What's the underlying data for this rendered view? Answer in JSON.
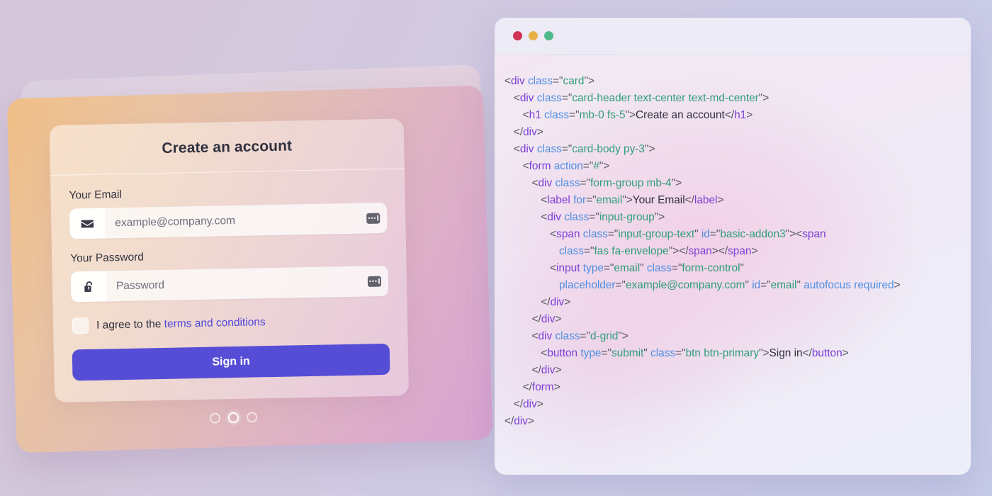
{
  "background": {
    "gradient_from": "#d5c6da",
    "gradient_to": "#c6cbe9"
  },
  "auth_card": {
    "title": "Create an account",
    "email": {
      "label": "Your Email",
      "placeholder": "example@company.com",
      "value": "",
      "addon_icon": "envelope-icon",
      "trailing_icon": "autofill-icon"
    },
    "password": {
      "label": "Your Password",
      "placeholder": "Password",
      "value": "",
      "addon_icon": "unlock-icon",
      "trailing_icon": "autofill-icon"
    },
    "agreement": {
      "checked": false,
      "text": "I agree to the ",
      "link_text": "terms and conditions",
      "link_color": "#4f47d8"
    },
    "submit": {
      "label": "Sign in",
      "color": "#564dd6"
    },
    "carousel": {
      "count": 3,
      "active_index": 1
    },
    "panel_gradient_from": "#f0bf87",
    "panel_gradient_to": "#d8a4d2"
  },
  "code_window": {
    "traffic_lights": [
      {
        "name": "close",
        "color": "#cf3253"
      },
      {
        "name": "minimize",
        "color": "#e9b148"
      },
      {
        "name": "maximize",
        "color": "#4fb98a"
      }
    ],
    "language": "html",
    "syntax_colors": {
      "tag": "#7b3fd4",
      "attribute": "#4f8fe0",
      "string": "#2f9e79",
      "text": "#2f2f3c",
      "punctuation": "#55555f"
    },
    "lines": [
      [
        {
          "t": "pun",
          "v": "<"
        },
        {
          "t": "tag",
          "v": "div"
        },
        {
          "t": "pun",
          "v": " "
        },
        {
          "t": "attr",
          "v": "class"
        },
        {
          "t": "pun",
          "v": "=\""
        },
        {
          "t": "str",
          "v": "card"
        },
        {
          "t": "pun",
          "v": "\">"
        }
      ],
      [
        {
          "t": "pun",
          "v": "   <"
        },
        {
          "t": "tag",
          "v": "div"
        },
        {
          "t": "pun",
          "v": " "
        },
        {
          "t": "attr",
          "v": "class"
        },
        {
          "t": "pun",
          "v": "=\""
        },
        {
          "t": "str",
          "v": "card-header text-center text-md-center"
        },
        {
          "t": "pun",
          "v": "\">"
        }
      ],
      [
        {
          "t": "pun",
          "v": "      <"
        },
        {
          "t": "tag",
          "v": "h1"
        },
        {
          "t": "pun",
          "v": " "
        },
        {
          "t": "attr",
          "v": "class"
        },
        {
          "t": "pun",
          "v": "=\""
        },
        {
          "t": "str",
          "v": "mb-0 fs-5"
        },
        {
          "t": "pun",
          "v": "\">"
        },
        {
          "t": "txt",
          "v": "Create an account"
        },
        {
          "t": "pun",
          "v": "</"
        },
        {
          "t": "tag",
          "v": "h1"
        },
        {
          "t": "pun",
          "v": ">"
        }
      ],
      [
        {
          "t": "pun",
          "v": "   </"
        },
        {
          "t": "tag",
          "v": "div"
        },
        {
          "t": "pun",
          "v": ">"
        }
      ],
      [
        {
          "t": "pun",
          "v": "   <"
        },
        {
          "t": "tag",
          "v": "div"
        },
        {
          "t": "pun",
          "v": " "
        },
        {
          "t": "attr",
          "v": "class"
        },
        {
          "t": "pun",
          "v": "=\""
        },
        {
          "t": "str",
          "v": "card-body py-3"
        },
        {
          "t": "pun",
          "v": "\">"
        }
      ],
      [
        {
          "t": "pun",
          "v": "      <"
        },
        {
          "t": "tag",
          "v": "form"
        },
        {
          "t": "pun",
          "v": " "
        },
        {
          "t": "attr",
          "v": "action"
        },
        {
          "t": "pun",
          "v": "=\""
        },
        {
          "t": "str",
          "v": "#"
        },
        {
          "t": "pun",
          "v": "\">"
        }
      ],
      [
        {
          "t": "pun",
          "v": "         <"
        },
        {
          "t": "tag",
          "v": "div"
        },
        {
          "t": "pun",
          "v": " "
        },
        {
          "t": "attr",
          "v": "class"
        },
        {
          "t": "pun",
          "v": "=\""
        },
        {
          "t": "str",
          "v": "form-group mb-4"
        },
        {
          "t": "pun",
          "v": "\">"
        }
      ],
      [
        {
          "t": "pun",
          "v": "            <"
        },
        {
          "t": "tag",
          "v": "label"
        },
        {
          "t": "pun",
          "v": " "
        },
        {
          "t": "attr",
          "v": "for"
        },
        {
          "t": "pun",
          "v": "=\""
        },
        {
          "t": "str",
          "v": "email"
        },
        {
          "t": "pun",
          "v": "\">"
        },
        {
          "t": "txt",
          "v": "Your Email"
        },
        {
          "t": "pun",
          "v": "</"
        },
        {
          "t": "tag",
          "v": "label"
        },
        {
          "t": "pun",
          "v": ">"
        }
      ],
      [
        {
          "t": "pun",
          "v": "            <"
        },
        {
          "t": "tag",
          "v": "div"
        },
        {
          "t": "pun",
          "v": " "
        },
        {
          "t": "attr",
          "v": "class"
        },
        {
          "t": "pun",
          "v": "=\""
        },
        {
          "t": "str",
          "v": "input-group"
        },
        {
          "t": "pun",
          "v": "\">"
        }
      ],
      [
        {
          "t": "pun",
          "v": "               <"
        },
        {
          "t": "tag",
          "v": "span"
        },
        {
          "t": "pun",
          "v": " "
        },
        {
          "t": "attr",
          "v": "class"
        },
        {
          "t": "pun",
          "v": "=\""
        },
        {
          "t": "str",
          "v": "input-group-text"
        },
        {
          "t": "pun",
          "v": "\" "
        },
        {
          "t": "attr",
          "v": "id"
        },
        {
          "t": "pun",
          "v": "=\""
        },
        {
          "t": "str",
          "v": "basic-addon3"
        },
        {
          "t": "pun",
          "v": "\"><"
        },
        {
          "t": "tag",
          "v": "span"
        }
      ],
      [
        {
          "t": "pun",
          "v": "                  "
        },
        {
          "t": "attr",
          "v": "class"
        },
        {
          "t": "pun",
          "v": "=\""
        },
        {
          "t": "str",
          "v": "fas fa-envelope"
        },
        {
          "t": "pun",
          "v": "\"></"
        },
        {
          "t": "tag",
          "v": "span"
        },
        {
          "t": "pun",
          "v": "></"
        },
        {
          "t": "tag",
          "v": "span"
        },
        {
          "t": "pun",
          "v": ">"
        }
      ],
      [
        {
          "t": "pun",
          "v": "               <"
        },
        {
          "t": "tag",
          "v": "input"
        },
        {
          "t": "pun",
          "v": " "
        },
        {
          "t": "attr",
          "v": "type"
        },
        {
          "t": "pun",
          "v": "=\""
        },
        {
          "t": "str",
          "v": "email"
        },
        {
          "t": "pun",
          "v": "\" "
        },
        {
          "t": "attr",
          "v": "class"
        },
        {
          "t": "pun",
          "v": "=\""
        },
        {
          "t": "str",
          "v": "form-control"
        },
        {
          "t": "pun",
          "v": "\""
        }
      ],
      [
        {
          "t": "pun",
          "v": "                  "
        },
        {
          "t": "attr",
          "v": "placeholder"
        },
        {
          "t": "pun",
          "v": "=\""
        },
        {
          "t": "str",
          "v": "example@company.com"
        },
        {
          "t": "pun",
          "v": "\" "
        },
        {
          "t": "attr",
          "v": "id"
        },
        {
          "t": "pun",
          "v": "=\""
        },
        {
          "t": "str",
          "v": "email"
        },
        {
          "t": "pun",
          "v": "\" "
        },
        {
          "t": "attr",
          "v": "autofocus required"
        },
        {
          "t": "pun",
          "v": ">"
        }
      ],
      [
        {
          "t": "pun",
          "v": "            </"
        },
        {
          "t": "tag",
          "v": "div"
        },
        {
          "t": "pun",
          "v": ">"
        }
      ],
      [
        {
          "t": "pun",
          "v": "         </"
        },
        {
          "t": "tag",
          "v": "div"
        },
        {
          "t": "pun",
          "v": ">"
        }
      ],
      [
        {
          "t": "pun",
          "v": "         <"
        },
        {
          "t": "tag",
          "v": "div"
        },
        {
          "t": "pun",
          "v": " "
        },
        {
          "t": "attr",
          "v": "class"
        },
        {
          "t": "pun",
          "v": "=\""
        },
        {
          "t": "str",
          "v": "d-grid"
        },
        {
          "t": "pun",
          "v": "\">"
        }
      ],
      [
        {
          "t": "pun",
          "v": "            <"
        },
        {
          "t": "tag",
          "v": "button"
        },
        {
          "t": "pun",
          "v": " "
        },
        {
          "t": "attr",
          "v": "type"
        },
        {
          "t": "pun",
          "v": "=\""
        },
        {
          "t": "str",
          "v": "submit"
        },
        {
          "t": "pun",
          "v": "\" "
        },
        {
          "t": "attr",
          "v": "class"
        },
        {
          "t": "pun",
          "v": "=\""
        },
        {
          "t": "str",
          "v": "btn btn-primary"
        },
        {
          "t": "pun",
          "v": "\">"
        },
        {
          "t": "txt",
          "v": "Sign in"
        },
        {
          "t": "pun",
          "v": "</"
        },
        {
          "t": "tag",
          "v": "button"
        },
        {
          "t": "pun",
          "v": ">"
        }
      ],
      [
        {
          "t": "pun",
          "v": "         </"
        },
        {
          "t": "tag",
          "v": "div"
        },
        {
          "t": "pun",
          "v": ">"
        }
      ],
      [
        {
          "t": "pun",
          "v": "      </"
        },
        {
          "t": "tag",
          "v": "form"
        },
        {
          "t": "pun",
          "v": ">"
        }
      ],
      [
        {
          "t": "pun",
          "v": "   </"
        },
        {
          "t": "tag",
          "v": "div"
        },
        {
          "t": "pun",
          "v": ">"
        }
      ],
      [
        {
          "t": "pun",
          "v": "</"
        },
        {
          "t": "tag",
          "v": "div"
        },
        {
          "t": "pun",
          "v": ">"
        }
      ]
    ]
  }
}
